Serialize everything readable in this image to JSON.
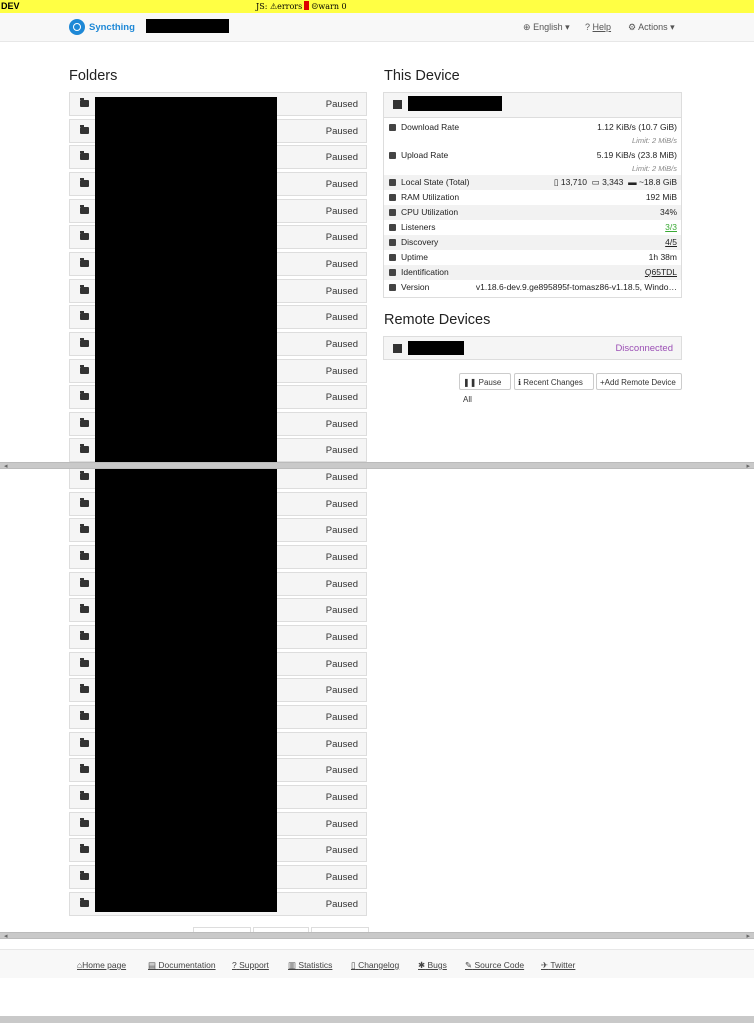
{
  "devbar": {
    "dev": "DEV",
    "js": "JS:",
    "errors": "errors",
    "warn": "warn 0"
  },
  "nav": {
    "brand": "Syncthing",
    "language": "English",
    "help": "Help",
    "actions": "Actions"
  },
  "folders": {
    "title": "Folders",
    "items": [
      "Paused",
      "Paused",
      "Paused",
      "Paused",
      "Paused",
      "Paused",
      "Paused",
      "Paused",
      "Paused",
      "Paused",
      "Paused",
      "Paused",
      "Paused",
      "Paused",
      "Paused",
      "Paused",
      "Paused",
      "Paused",
      "Paused",
      "Paused",
      "Paused",
      "Paused",
      "Paused",
      "Paused",
      "Paused",
      "Paused",
      "Paused",
      "Paused",
      "Paused",
      "Paused",
      "Paused"
    ]
  },
  "this_device": {
    "title": "This Device",
    "download_label": "Download Rate",
    "download_value": "1.12 KiB/s (10.7 GiB)",
    "download_limit": "Limit: 2 MiB/s",
    "upload_label": "Upload Rate",
    "upload_value": "5.19 KiB/s (23.8 MiB)",
    "upload_limit": "Limit: 2 MiB/s",
    "local_state_label": "Local State (Total)",
    "local_files": "13,710",
    "local_dirs": "3,343",
    "local_size": "~18.8 GiB",
    "ram_label": "RAM Utilization",
    "ram_value": "192 MiB",
    "cpu_label": "CPU Utilization",
    "cpu_value": "34%",
    "listeners_label": "Listeners",
    "listeners_value": "3/3",
    "discovery_label": "Discovery",
    "discovery_value": "4/5",
    "uptime_label": "Uptime",
    "uptime_value": "1h 38m",
    "identification_label": "Identification",
    "identification_value": "Q65TDL",
    "version_label": "Version",
    "version_value": "v1.18.6-dev.9.ge895895f-tomasz86-v1.18.5, Windo…"
  },
  "remote": {
    "title": "Remote Devices",
    "status": "Disconnected"
  },
  "buttons": {
    "pause_all": "Pause All",
    "recent_changes": "Recent Changes",
    "add_remote": "Add Remote Device"
  },
  "footer": {
    "home": "Home page",
    "docs": "Documentation",
    "support": "Support",
    "stats": "Statistics",
    "changelog": "Changelog",
    "bugs": "Bugs",
    "source": "Source Code",
    "twitter": "Twitter"
  },
  "colors": {
    "brand": "#1e88d6",
    "disconnected": "#9b4fb5",
    "link": "#3b8fd8",
    "link_green": "#3aaa35",
    "devbar": "#ffff44"
  }
}
